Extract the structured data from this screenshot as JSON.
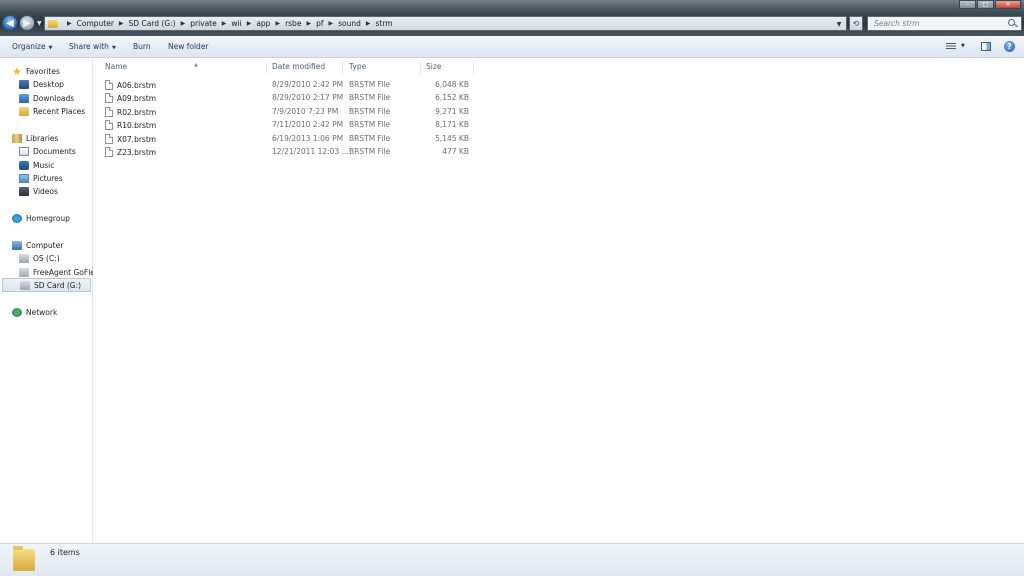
{
  "address": {
    "crumbs": [
      "Computer",
      "SD Card (G:)",
      "private",
      "wii",
      "app",
      "rsbe",
      "pf",
      "sound",
      "strm"
    ]
  },
  "search": {
    "placeholder": "Search strm"
  },
  "toolbar": {
    "organize": "Organize",
    "share_with": "Share with",
    "burn": "Burn",
    "new_folder": "New folder"
  },
  "nav": {
    "favorites": "Favorites",
    "desktop": "Desktop",
    "downloads": "Downloads",
    "recent_places": "Recent Places",
    "libraries": "Libraries",
    "documents": "Documents",
    "music": "Music",
    "pictures": "Pictures",
    "videos": "Videos",
    "homegroup": "Homegroup",
    "computer": "Computer",
    "os_c": "OS (C:)",
    "freeagent": "FreeAgent GoFlex",
    "sd_card": "SD Card (G:)",
    "network": "Network"
  },
  "columns": {
    "name": "Name",
    "date": "Date modified",
    "type": "Type",
    "size": "Size"
  },
  "files": [
    {
      "name": "A06.brstm",
      "date": "8/29/2010 2:42 PM",
      "type": "BRSTM File",
      "size": "6,048 KB"
    },
    {
      "name": "A09.brstm",
      "date": "8/29/2010 2:17 PM",
      "type": "BRSTM File",
      "size": "6,152 KB"
    },
    {
      "name": "R02.brstm",
      "date": "7/9/2010 7:23 PM",
      "type": "BRSTM File",
      "size": "9,271 KB"
    },
    {
      "name": "R10.brstm",
      "date": "7/11/2010 2:42 PM",
      "type": "BRSTM File",
      "size": "8,171 KB"
    },
    {
      "name": "X07.brstm",
      "date": "6/19/2013 1:06 PM",
      "type": "BRSTM File",
      "size": "5,145 KB"
    },
    {
      "name": "Z23.brstm",
      "date": "12/21/2011 12:03 ...",
      "type": "BRSTM File",
      "size": "477 KB"
    }
  ],
  "status": {
    "count": "6 items"
  }
}
